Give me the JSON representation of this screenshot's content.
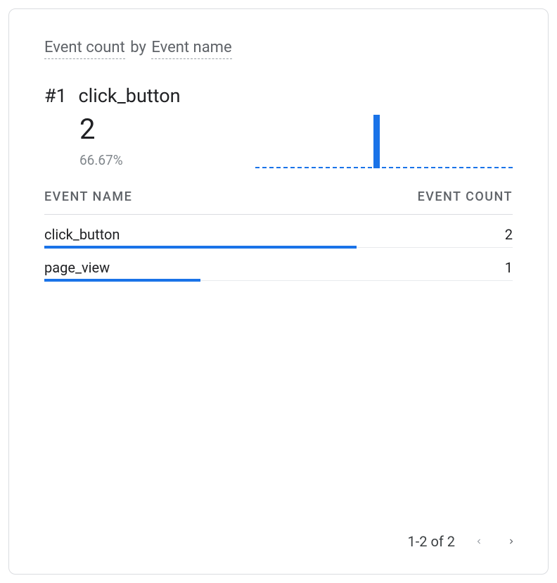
{
  "title": {
    "metric": "Event count",
    "by": "by",
    "dimension": "Event name"
  },
  "highlight": {
    "rank": "#1",
    "name": "click_button",
    "value": "2",
    "percent": "66.67%"
  },
  "columns": {
    "name": "EVENT NAME",
    "count": "EVENT COUNT"
  },
  "rows": [
    {
      "name": "click_button",
      "count": "2",
      "bar_pct": 66.67
    },
    {
      "name": "page_view",
      "count": "1",
      "bar_pct": 33.33
    }
  ],
  "pagination": {
    "label": "1-2 of 2"
  },
  "chart_data": {
    "type": "bar",
    "title": "Event count by Event name",
    "xlabel": "Event name",
    "ylabel": "Event count",
    "categories": [
      "click_button",
      "page_view"
    ],
    "values": [
      2,
      1
    ],
    "ylim": [
      0,
      2
    ]
  }
}
